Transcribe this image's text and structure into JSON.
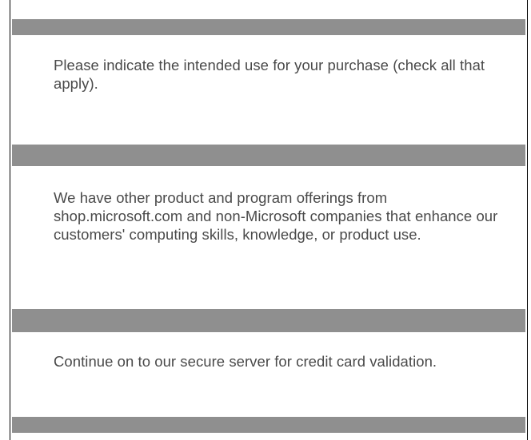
{
  "sections": [
    {
      "text": "Please indicate the intended use for your purchase (check all that apply)."
    },
    {
      "text": "We have other product and program offerings from shop.microsoft.com and non-Microsoft companies that enhance our customers' computing skills, knowledge, or product use."
    },
    {
      "text": "Continue on to our secure server for credit card validation."
    }
  ],
  "colors": {
    "divider": "#8f8f8f",
    "text": "#4a4a4a",
    "border": "#000000"
  }
}
